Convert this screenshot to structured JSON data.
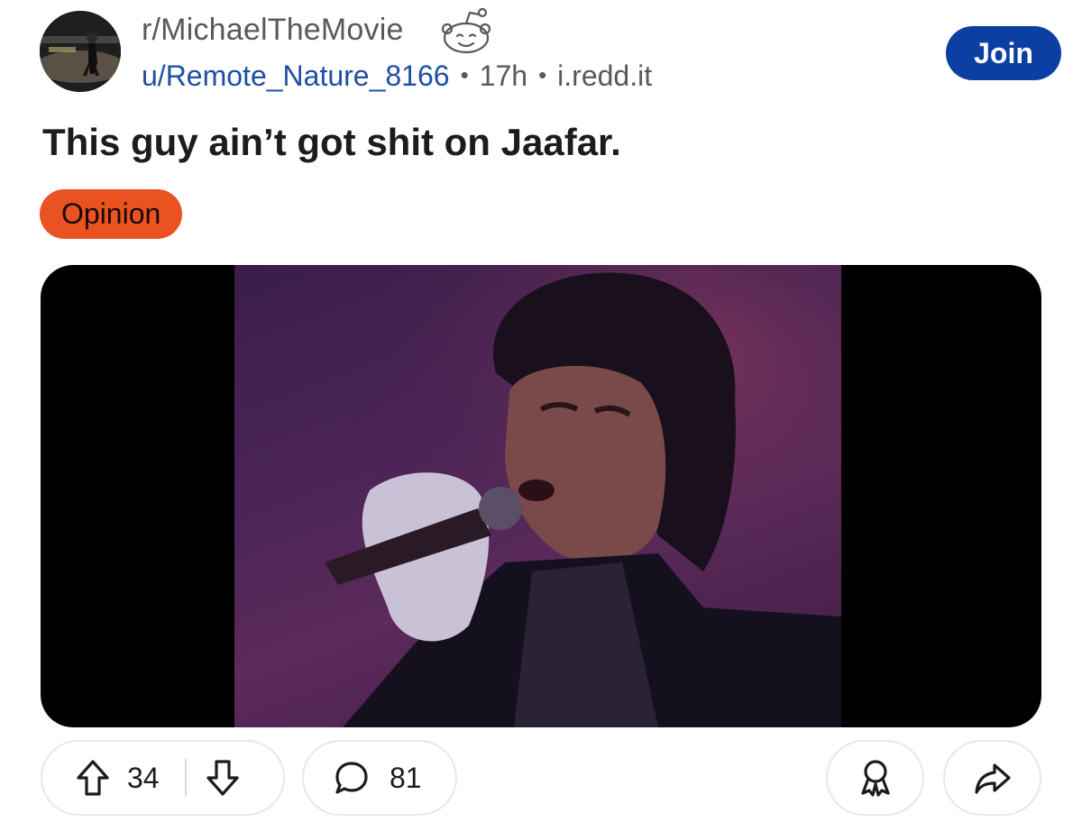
{
  "header": {
    "subreddit": "r/MichaelTheMovie",
    "user": "u/Remote_Nature_8166",
    "separator": "•",
    "time": "17h",
    "domain": "i.redd.it",
    "join_label": "Join"
  },
  "post": {
    "title": "This guy ain’t got shit on Jaafar.",
    "flair": "Opinion"
  },
  "actions": {
    "upvotes": "34",
    "comments": "81"
  },
  "colors": {
    "join_bg": "#0c3fa3",
    "flair_bg": "#ea5222",
    "username": "#1f4fa3"
  },
  "icons": [
    "snoo-icon",
    "upvote-icon",
    "downvote-icon",
    "comment-icon",
    "award-icon",
    "share-icon"
  ]
}
